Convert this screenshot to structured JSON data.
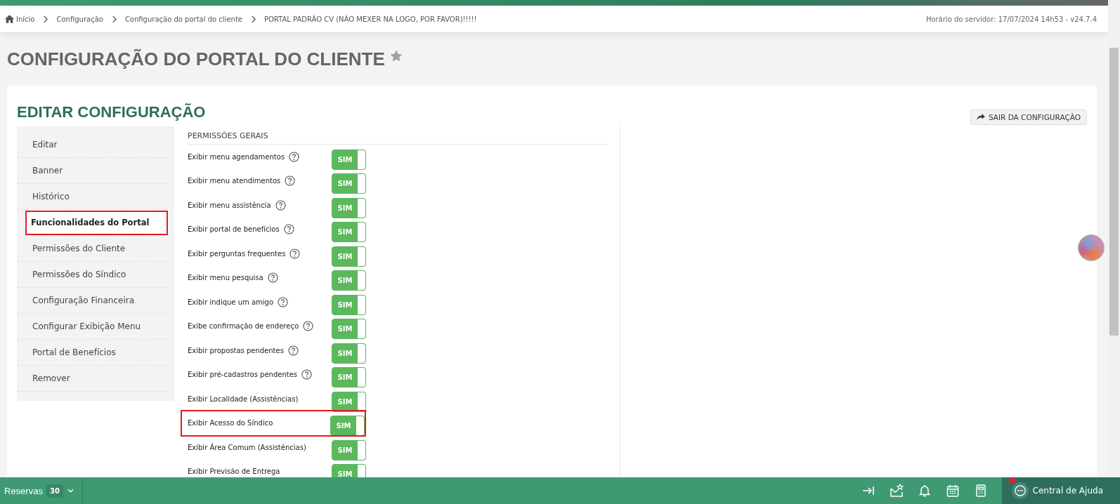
{
  "breadcrumb": [
    {
      "label": "Início",
      "home": true
    },
    {
      "label": "Configuração",
      "home": false
    },
    {
      "label": "Configuração do portal do cliente",
      "home": false
    },
    {
      "label": "PORTAL PADRÃO CV (NÃO MEXER NA LOGO, POR FAVOR)!!!!!",
      "home": false
    }
  ],
  "server_time": "Horário do servidor: 17/07/2024 14h53 - v24.7.4",
  "page_title": "CONFIGURAÇÃO DO PORTAL DO CLIENTE",
  "card": {
    "title": "EDITAR CONFIGURAÇÃO",
    "exit_button": "SAIR DA CONFIGURAÇÃO"
  },
  "sidebar": {
    "items": [
      {
        "label": "Editar",
        "selected": false,
        "highlighted": false
      },
      {
        "label": "Banner",
        "selected": false,
        "highlighted": false
      },
      {
        "label": "Histórico",
        "selected": false,
        "highlighted": false
      },
      {
        "label": "Funcionalidades do Portal",
        "selected": true,
        "highlighted": true
      },
      {
        "label": "Permissões do Cliente",
        "selected": false,
        "highlighted": false
      },
      {
        "label": "Permissões do Síndico",
        "selected": false,
        "highlighted": false
      },
      {
        "label": "Configuração Financeira",
        "selected": false,
        "highlighted": false
      },
      {
        "label": "Configurar Exibição Menu",
        "selected": false,
        "highlighted": false
      },
      {
        "label": "Portal de Benefícios",
        "selected": false,
        "highlighted": false
      },
      {
        "label": "Remover",
        "selected": false,
        "highlighted": false
      }
    ]
  },
  "permissions": {
    "title": "PERMISSÕES GERAIS",
    "rows": [
      {
        "label": "Exibir menu agendamentos",
        "help": true,
        "on": true,
        "toggle_label": "SIM",
        "highlighted": false
      },
      {
        "label": "Exibir menu atendimentos",
        "help": true,
        "on": true,
        "toggle_label": "SIM",
        "highlighted": false
      },
      {
        "label": "Exibir menu assistência",
        "help": true,
        "on": true,
        "toggle_label": "SIM",
        "highlighted": false
      },
      {
        "label": "Exibir portal de benefícios",
        "help": true,
        "on": true,
        "toggle_label": "SIM",
        "highlighted": false
      },
      {
        "label": "Exibir perguntas frequentes",
        "help": true,
        "on": true,
        "toggle_label": "SIM",
        "highlighted": false
      },
      {
        "label": "Exibir menu pesquisa",
        "help": true,
        "on": true,
        "toggle_label": "SIM",
        "highlighted": false
      },
      {
        "label": "Exibir indique um amigo",
        "help": true,
        "on": true,
        "toggle_label": "SIM",
        "highlighted": false
      },
      {
        "label": "Exibe confirmação de endereço",
        "help": true,
        "on": true,
        "toggle_label": "SIM",
        "highlighted": false
      },
      {
        "label": "Exibir propostas pendentes",
        "help": true,
        "on": true,
        "toggle_label": "SIM",
        "highlighted": false
      },
      {
        "label": "Exibir pré-cadastros pendentes",
        "help": true,
        "on": true,
        "toggle_label": "SIM",
        "highlighted": false
      },
      {
        "label": "Exibir Localidade (Assistências)",
        "help": false,
        "on": true,
        "toggle_label": "SIM",
        "highlighted": false
      },
      {
        "label": "Exibir Acesso do Síndico",
        "help": false,
        "on": true,
        "toggle_label": "SIM",
        "highlighted": true
      },
      {
        "label": "Exibir Área Comum (Assistências)",
        "help": false,
        "on": true,
        "toggle_label": "SIM",
        "highlighted": false
      },
      {
        "label": "Exibir Previsão de Entrega",
        "help": false,
        "on": true,
        "toggle_label": "SIM",
        "highlighted": false
      }
    ]
  },
  "bottom_bar": {
    "reservas_label": "Reservas",
    "reservas_count": "30",
    "help_center": "Central de Ajuda",
    "help_notification": true
  }
}
